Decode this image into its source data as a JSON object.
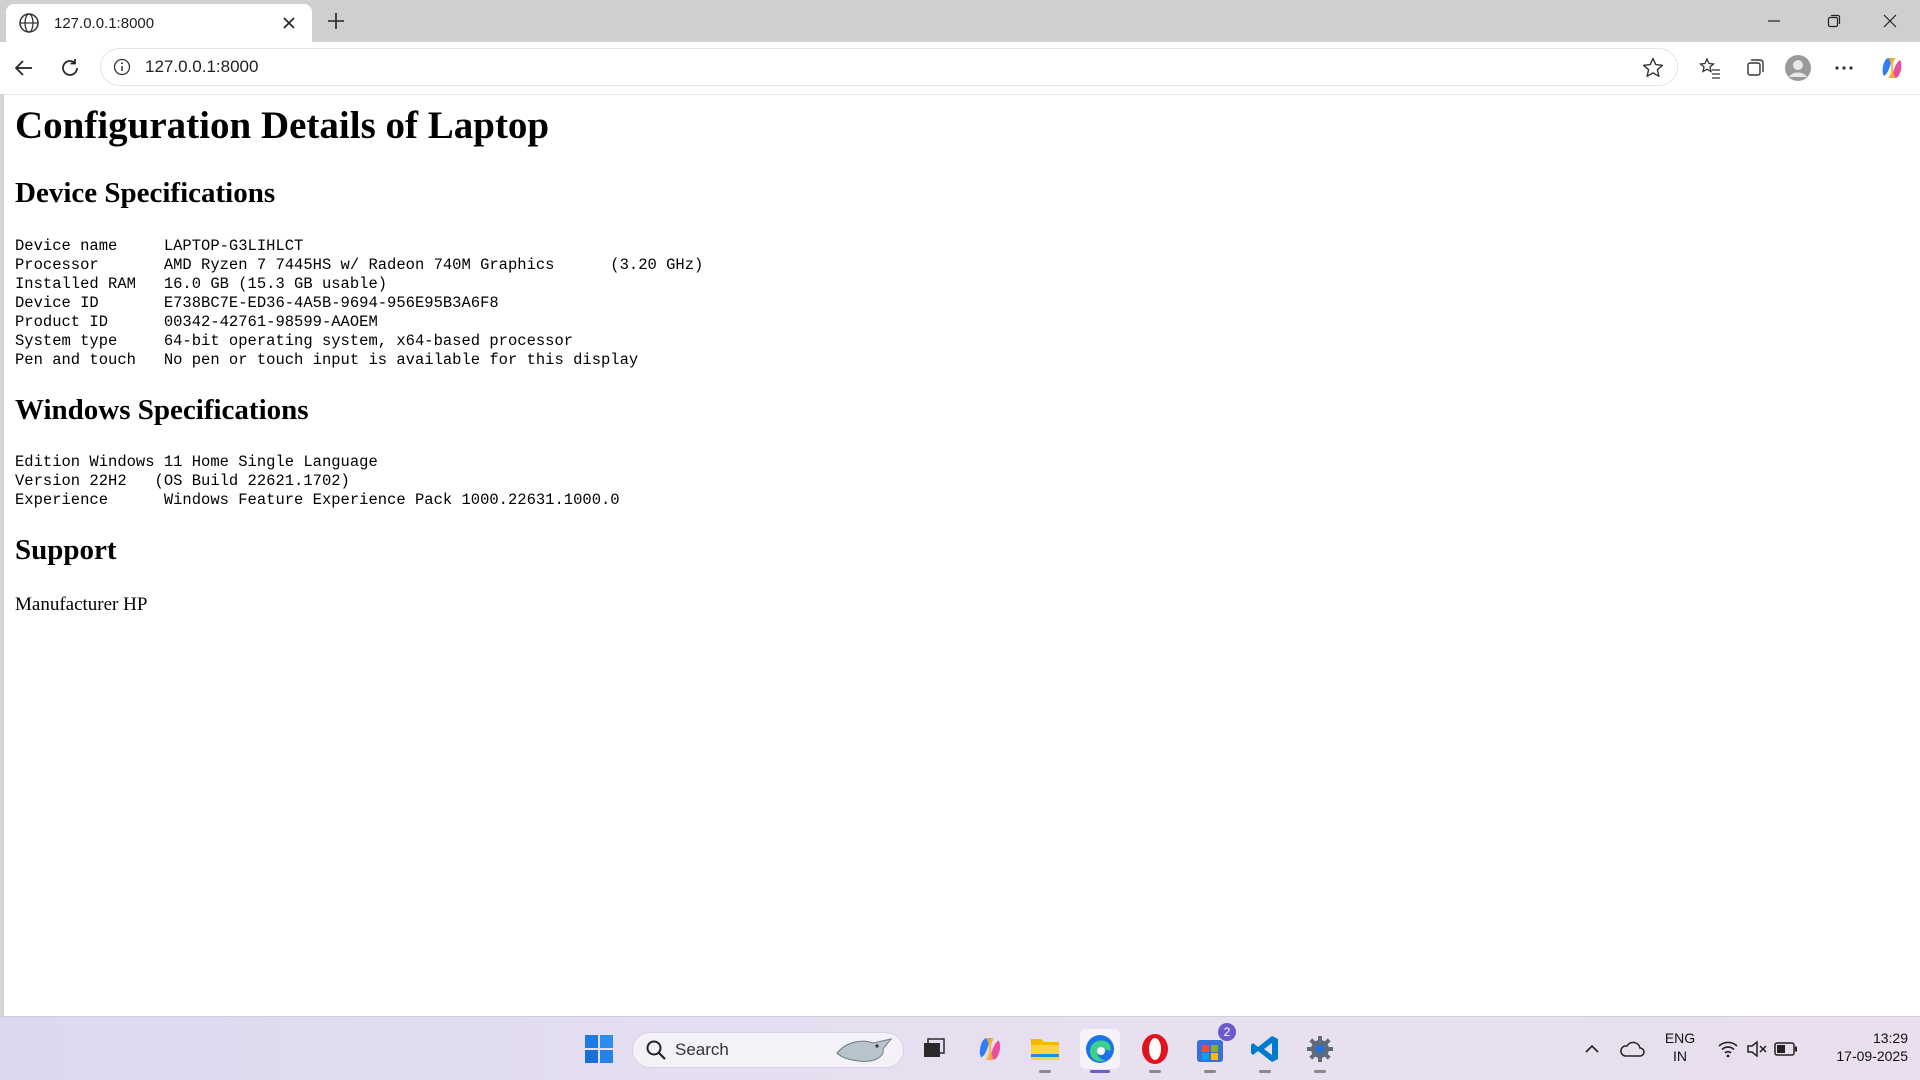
{
  "browser": {
    "tab_title": "127.0.0.1:8000",
    "url": "127.0.0.1:8000"
  },
  "page": {
    "title": "Configuration Details of Laptop",
    "device_heading": "Device Specifications",
    "device_specs": "Device name     LAPTOP-G3LIHLCT\nProcessor       AMD Ryzen 7 7445HS w/ Radeon 740M Graphics      (3.20 GHz)\nInstalled RAM   16.0 GB (15.3 GB usable)\nDevice ID       E738BC7E-ED36-4A5B-9694-956E95B3A6F8\nProduct ID      00342-42761-98599-AAOEM\nSystem type     64-bit operating system, x64-based processor\nPen and touch   No pen or touch input is available for this display",
    "windows_heading": "Windows Specifications",
    "windows_specs": "Edition Windows 11 Home Single Language\nVersion 22H2   (OS Build 22621.1702)\nExperience      Windows Feature Experience Pack 1000.22631.1000.0",
    "support_heading": "Support",
    "support_text": "Manufacturer HP"
  },
  "taskbar": {
    "search_label": "Search",
    "store_badge": "2",
    "tray": {
      "lang_top": "ENG",
      "lang_bottom": "IN",
      "time": "13:29",
      "date": "17-09-2025"
    }
  },
  "colors": {
    "accent": "#6b5fd0",
    "edge_blue": "#1a73e8",
    "opera_red": "#e0141e",
    "vscode_blue": "#007acc"
  }
}
